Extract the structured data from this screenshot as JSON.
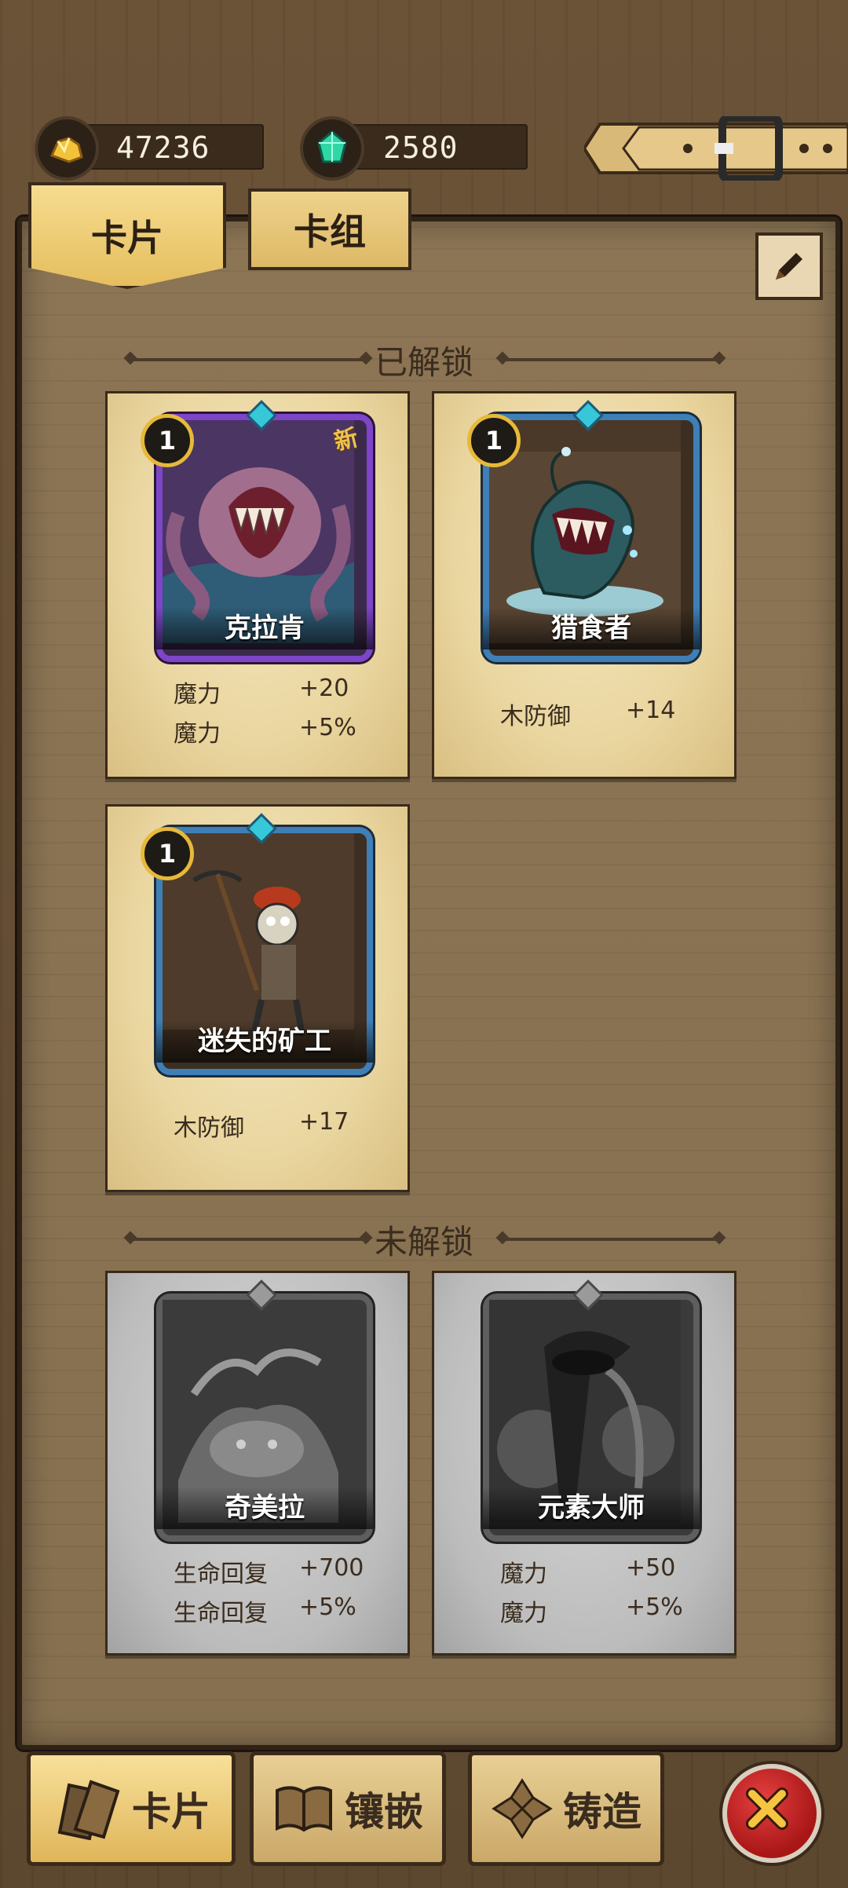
{
  "resources": {
    "gold": {
      "value": "47236",
      "icon": "gold-nugget-icon"
    },
    "gem": {
      "value": "2580",
      "icon": "green-crystal-icon"
    }
  },
  "tabs": {
    "cards": "卡片",
    "deck": "卡组"
  },
  "sections": {
    "unlocked": "已解锁",
    "locked": "未解锁"
  },
  "unlocked_cards": [
    {
      "name": "克拉肯",
      "level": "1",
      "new_label": "新",
      "frame": "purple",
      "stats": [
        {
          "label": "魔力",
          "value": "+20"
        },
        {
          "label": "魔力",
          "value": "+5%"
        }
      ]
    },
    {
      "name": "猎食者",
      "level": "1",
      "frame": "blue",
      "stats": [
        {
          "label": "木防御",
          "value": "+14"
        }
      ]
    },
    {
      "name": "迷失的矿工",
      "level": "1",
      "frame": "blue",
      "stats": [
        {
          "label": "木防御",
          "value": "+17"
        }
      ]
    }
  ],
  "locked_cards": [
    {
      "name": "奇美拉",
      "stats": [
        {
          "label": "生命回复",
          "value": "+700"
        },
        {
          "label": "生命回复",
          "value": "+5%"
        }
      ]
    },
    {
      "name": "元素大师",
      "stats": [
        {
          "label": "魔力",
          "value": "+50"
        },
        {
          "label": "魔力",
          "value": "+5%"
        }
      ]
    }
  ],
  "bottom_nav": {
    "cards": "卡片",
    "inlay": "镶嵌",
    "forge": "铸造"
  }
}
